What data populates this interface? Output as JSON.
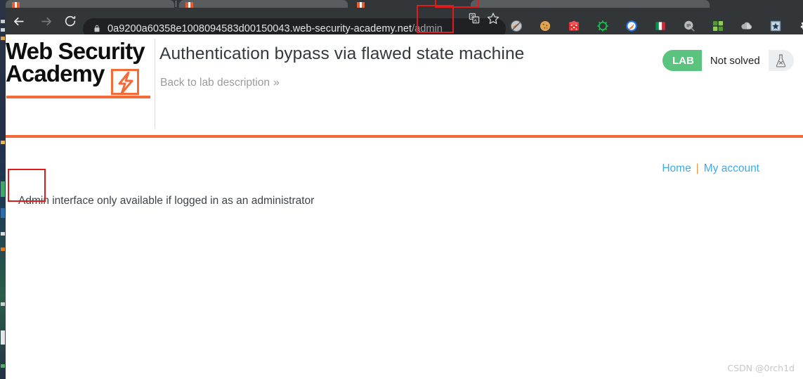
{
  "browser": {
    "tabstrip": {
      "tabs": [
        {
          "label": "",
          "favicon": "burp-icon",
          "active": false
        },
        {
          "label": "",
          "favicon": "burp-icon",
          "active": false
        },
        {
          "label": "",
          "favicon": "burp-icon",
          "active": true
        },
        {
          "label": "",
          "favicon": "none",
          "active": false
        }
      ]
    },
    "nav": {
      "back_label": "back-arrow",
      "forward_label": "forward-arrow",
      "reload_label": "reload"
    },
    "omnibox": {
      "lock": "lock-icon",
      "url_host": "0a9200a60358e1008094583d00150043.web-security-academy.net",
      "url_path": "/admin",
      "translate_icon": "translate-icon",
      "bookmark_icon": "star-icon"
    },
    "extensions": [
      {
        "name": "noscript-icon",
        "color": "#b9bcbe"
      },
      {
        "name": "cookie-editor-icon",
        "color": "#e0a452"
      },
      {
        "name": "dice-icon",
        "color": "#e52f2f"
      },
      {
        "name": "gear-outline-icon",
        "color": "#16c04a"
      },
      {
        "name": "brush-circle-icon",
        "color": "#1a73e8"
      },
      {
        "name": "italy-flag-icon",
        "color": "#009246"
      },
      {
        "name": "ip-lookup-icon",
        "color": "#b0b3b6"
      },
      {
        "name": "qr-code-icon",
        "color": "#6cc24a"
      },
      {
        "name": "cloud-icon",
        "color": "#aeb1b4"
      },
      {
        "name": "star-box-icon",
        "color": "#5b7f9e"
      },
      {
        "name": "puzzle-icon",
        "color": "#e8eaed"
      },
      {
        "name": "profile-icon",
        "color": "#e8eaed"
      },
      {
        "name": "more-menu-icon",
        "color": "#e8eaed"
      }
    ]
  },
  "lab": {
    "logo_line1": "Web Security",
    "logo_line2": "Academy",
    "title": "Authentication bypass via flawed state machine",
    "back_link": "Back to lab description",
    "back_chevron": "»",
    "status_tag": "LAB",
    "status_value": "Not solved",
    "status_icon": "flask-icon",
    "accent_color": "#f26b38",
    "status_green": "#5ac37d"
  },
  "content": {
    "links": [
      {
        "label": "Home"
      },
      {
        "label": "My account"
      }
    ],
    "separator": "|",
    "message": "Admin interface only available if logged in as an administrator"
  },
  "annotations": [
    {
      "name": "annotation-url-admin",
      "target": "/admin",
      "color": "#e01b1b"
    },
    {
      "name": "annotation-admin-word",
      "target": "Admin",
      "color": "#e01b1b"
    },
    {
      "name": "annotation-tab",
      "target": "active-tab",
      "color": "#e01b1b"
    }
  ],
  "watermark": "CSDN @0rch1d"
}
